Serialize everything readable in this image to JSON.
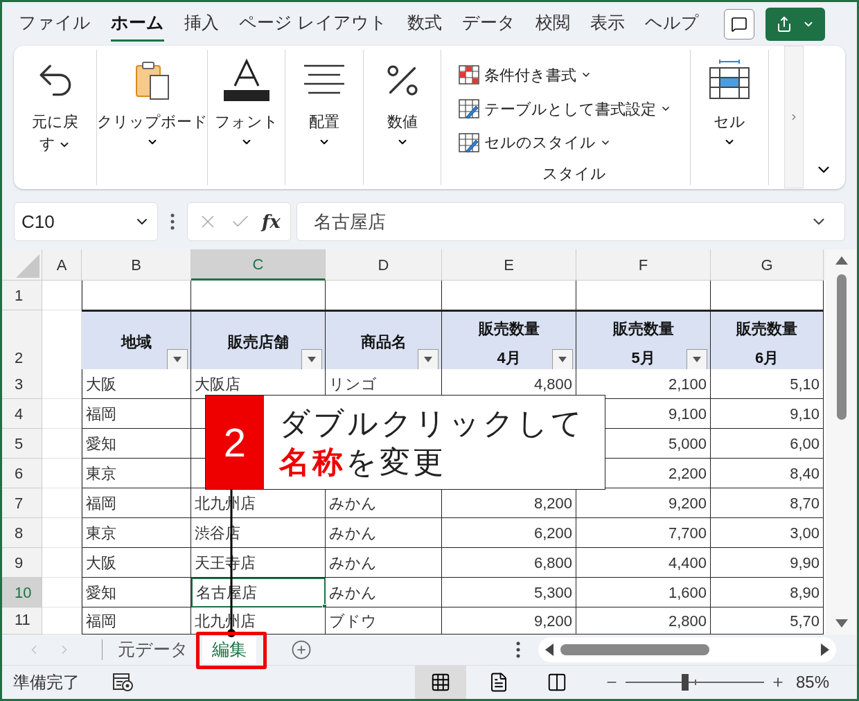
{
  "ribbon_tabs": [
    {
      "label": "ファイル",
      "selected": false
    },
    {
      "label": "ホーム",
      "selected": true
    },
    {
      "label": "挿入",
      "selected": false
    },
    {
      "label": "ページ レイアウト",
      "selected": false
    },
    {
      "label": "数式",
      "selected": false
    },
    {
      "label": "データ",
      "selected": false
    },
    {
      "label": "校閲",
      "selected": false
    },
    {
      "label": "表示",
      "selected": false
    },
    {
      "label": "ヘルプ",
      "selected": false
    }
  ],
  "ribbon": {
    "groups": [
      {
        "kind": "button",
        "label": "元に戻す",
        "dropdown": true
      },
      {
        "kind": "button",
        "label": "クリップボード",
        "dropdown": true
      },
      {
        "kind": "button",
        "label": "フォント",
        "dropdown": true
      },
      {
        "kind": "button",
        "label": "配置",
        "dropdown": true
      },
      {
        "kind": "button",
        "label": "数値",
        "dropdown": true
      },
      {
        "kind": "styles",
        "label": "スタイル",
        "items": [
          {
            "label": "条件付き書式",
            "dropdown": true
          },
          {
            "label": "テーブルとして書式設定",
            "dropdown": true
          },
          {
            "label": "セルのスタイル",
            "dropdown": true
          }
        ]
      },
      {
        "kind": "button",
        "label": "セル",
        "dropdown": true
      }
    ]
  },
  "formula_bar": {
    "name_box": "C10",
    "fx": "fx",
    "value": "名古屋店"
  },
  "sheet": {
    "columns": [
      {
        "label": "A",
        "selected": false
      },
      {
        "label": "B",
        "selected": false
      },
      {
        "label": "C",
        "selected": true
      },
      {
        "label": "D",
        "selected": false
      },
      {
        "label": "E",
        "selected": false
      },
      {
        "label": "F",
        "selected": false
      },
      {
        "label": "G",
        "selected": false
      }
    ],
    "rows": [
      {
        "number": "1",
        "selected": false,
        "cells": []
      },
      {
        "number": "2",
        "selected": false,
        "kind": "header",
        "cells": [
          {
            "lines": [
              "地域"
            ],
            "filter": true
          },
          {
            "lines": [
              "販売店舗"
            ],
            "filter": true
          },
          {
            "lines": [
              "商品名"
            ],
            "filter": true
          },
          {
            "lines": [
              "販売数量",
              "4月"
            ],
            "filter": true
          },
          {
            "lines": [
              "販売数量",
              "5月"
            ],
            "filter": true
          },
          {
            "lines": [
              "販売数量",
              "6月"
            ],
            "filter": false
          }
        ]
      },
      {
        "number": "3",
        "selected": false,
        "cells": [
          "大阪",
          "大阪店",
          "リンゴ",
          "4,800",
          "2,100",
          "5,10"
        ]
      },
      {
        "number": "4",
        "selected": false,
        "cells": [
          "福岡",
          null,
          null,
          null,
          "9,100",
          "9,10"
        ]
      },
      {
        "number": "5",
        "selected": false,
        "cells": [
          "愛知",
          null,
          null,
          null,
          "5,000",
          "6,00"
        ]
      },
      {
        "number": "6",
        "selected": false,
        "cells": [
          "東京",
          null,
          null,
          null,
          "2,200",
          "8,40"
        ]
      },
      {
        "number": "7",
        "selected": false,
        "cells": [
          "福岡",
          "北九州店",
          "みかん",
          "8,200",
          "9,200",
          "8,70"
        ]
      },
      {
        "number": "8",
        "selected": false,
        "cells": [
          "東京",
          "渋谷店",
          "みかん",
          "6,200",
          "7,700",
          "3,00"
        ]
      },
      {
        "number": "9",
        "selected": false,
        "cells": [
          "大阪",
          "天王寺店",
          "みかん",
          "6,800",
          "4,400",
          "9,90"
        ]
      },
      {
        "number": "10",
        "selected": true,
        "cells": [
          "愛知",
          "名古屋店",
          "みかん",
          "5,300",
          "1,600",
          "8,90"
        ]
      },
      {
        "number": "11",
        "selected": false,
        "cells": [
          "福岡",
          "北九州店",
          "ブドウ",
          "9,200",
          "2,800",
          "5,70"
        ]
      }
    ]
  },
  "sheet_tabs": [
    {
      "label": "元データ",
      "selected": false
    },
    {
      "label": "編集",
      "selected": true
    }
  ],
  "status_bar": {
    "text": "準備完了",
    "views": [
      {
        "kind": "normal",
        "selected": true
      },
      {
        "kind": "page_layout",
        "selected": false
      },
      {
        "kind": "page_break",
        "selected": false
      }
    ],
    "zoom": {
      "level": 0.43,
      "reading": "85%"
    }
  },
  "callout": {
    "number": "2",
    "lines": [
      "ダブルクリックして",
      "**名称**を変更"
    ]
  }
}
